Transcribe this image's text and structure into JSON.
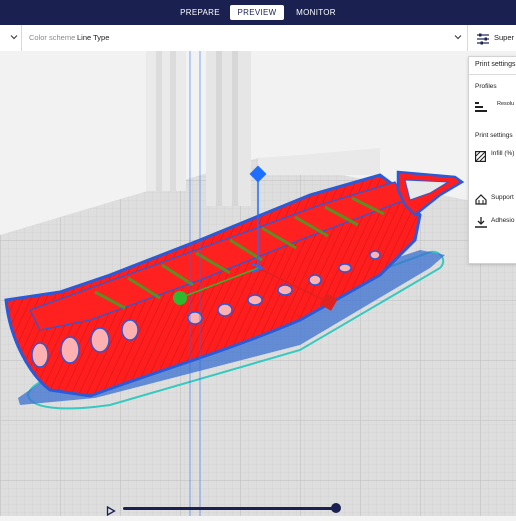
{
  "stages": [
    {
      "label": "PREPARE",
      "active": false
    },
    {
      "label": "PREVIEW",
      "active": true
    },
    {
      "label": "MONITOR",
      "active": false
    }
  ],
  "toolbar": {
    "color_scheme_label": "Color scheme",
    "color_scheme_value": "Line Type",
    "print_settings_summary": "Super Q"
  },
  "print_panel": {
    "title": "Print settings",
    "profiles_label": "Profiles",
    "resolution_label": "Resolu",
    "section_label": "Print settings",
    "infill_label": "Infill (%)",
    "support_label": "Support",
    "adhesion_label": "Adhesio"
  },
  "colors": {
    "header_bg": "#1a2151",
    "model_red": "#ff1d1d",
    "outline_blue": "#2a5ad8",
    "infill_green": "#6a9a2a",
    "skirt_cyan": "#35c9c0",
    "axis_green": "#2db82d",
    "axis_blue": "#1f6fff",
    "axis_red": "#e12020"
  },
  "icons": [
    "chevron-down-icon",
    "print-settings-icon",
    "profile-icon",
    "infill-icon",
    "support-icon",
    "adhesion-icon",
    "play-icon"
  ]
}
